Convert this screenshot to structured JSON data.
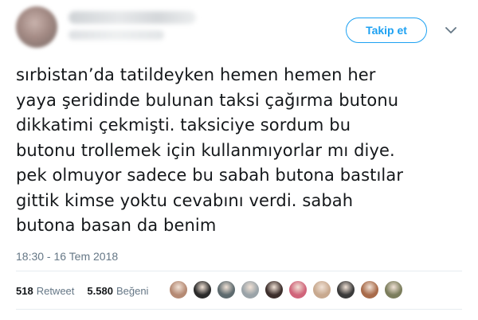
{
  "header": {
    "follow_label": "Takip et",
    "avatar_icon": "avatar-blurred",
    "caret_icon": "chevron-down-icon"
  },
  "tweet": {
    "text": "sırbistan’da tatildeyken hemen hemen her\nyaya şeridinde bulunan taksi çağırma butonu\ndikkatimi çekmişti. taksiciye sordum bu\nbutonu trollemek için kullanmıyorlar mı diye.\npek olmuyor sadece bu sabah butona bastılar\ngittik kimse yoktu cevabını verdi. sabah\nbutona basan da benim",
    "timestamp": "18:30 - 16 Tem 2018"
  },
  "stats": {
    "retweets_count": "518",
    "retweets_label": "Retweet",
    "likes_count": "5.580",
    "likes_label": "Beğeni"
  },
  "colors": {
    "accent": "#1da1f2",
    "muted": "#657786",
    "divider": "#e6ecf0"
  },
  "liker_avatars": [
    {
      "name": "liker-avatar-1",
      "color": "#b58a74"
    },
    {
      "name": "liker-avatar-2",
      "color": "#2b2b2b"
    },
    {
      "name": "liker-avatar-3",
      "color": "#5d6a6e"
    },
    {
      "name": "liker-avatar-4",
      "color": "#9aa3a8"
    },
    {
      "name": "liker-avatar-5",
      "color": "#3d2f2c"
    },
    {
      "name": "liker-avatar-6",
      "color": "#d0647a"
    },
    {
      "name": "liker-avatar-7",
      "color": "#c8a98f"
    },
    {
      "name": "liker-avatar-8",
      "color": "#3a3a3a"
    },
    {
      "name": "liker-avatar-9",
      "color": "#a86b4a"
    },
    {
      "name": "liker-avatar-10",
      "color": "#7b7d5c"
    }
  ]
}
